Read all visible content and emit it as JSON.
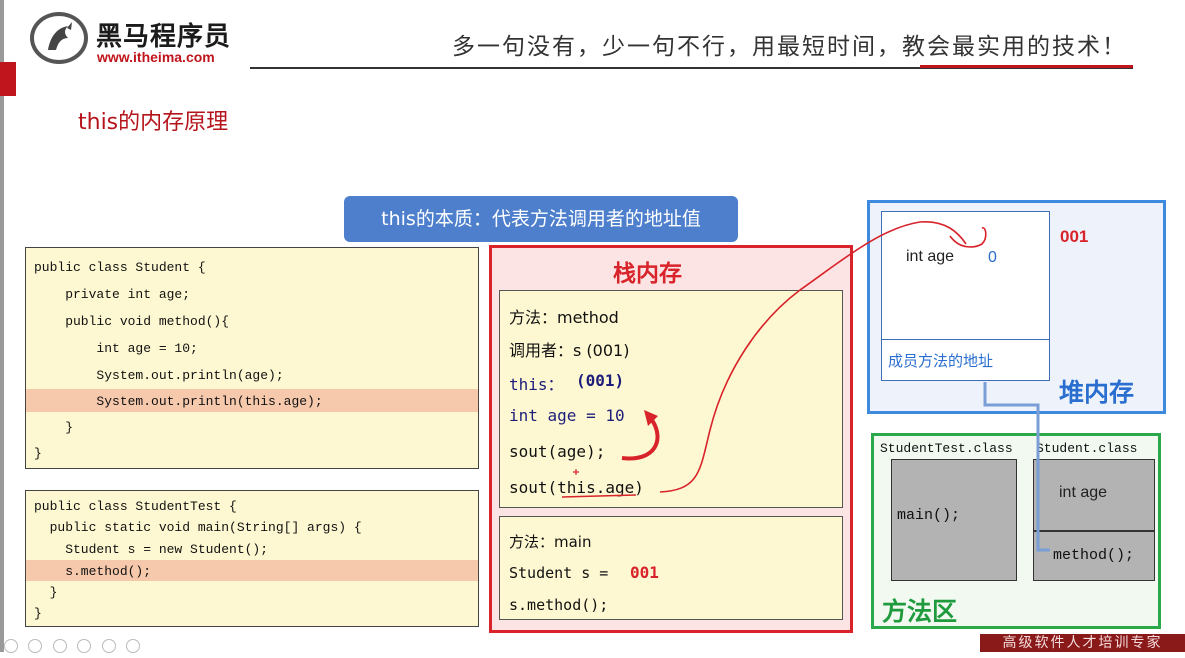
{
  "header": {
    "logo_text": "黑马程序员",
    "logo_url": "www.itheima.com",
    "slogan": "多一句没有，少一句不行，用最短时间，教会最实用的技术！"
  },
  "slide_title": "this的内存原理",
  "banner": "this的本质：代表方法调用者的地址值",
  "student_code": [
    "public class Student {",
    "    private int age;",
    "    public void method(){",
    "        int age = 10;",
    "        System.out.println(age);",
    "        System.out.println(this.age);",
    "    }",
    "}"
  ],
  "student_test_code": [
    "public class StudentTest {",
    "  public static void main(String[] args) {",
    "    Student s = new Student();",
    "    s.method();",
    "  }",
    "}"
  ],
  "stack": {
    "title": "栈内存",
    "method_frame": {
      "method_label": "方法：method",
      "caller_label": "调用者：s (001)",
      "this_label": "this：",
      "this_value": "(001)",
      "local_var": "int age = 10",
      "sout_age": "sout(age);",
      "sout_this_age": "sout(this.age)"
    },
    "main_frame": {
      "method_label": "方法：main",
      "student_decl": "Student s = ",
      "student_addr": "001",
      "call": "s.method();"
    }
  },
  "heap": {
    "title": "堆内存",
    "address": "001",
    "field_label": "int age",
    "field_value": "0",
    "method_ref": "成员方法的地址"
  },
  "method_area": {
    "title": "方法区",
    "student_test_class": "StudentTest.class",
    "student_class": "Student.class",
    "main_method": "main();",
    "field": "int age",
    "method": "method();"
  },
  "watermark": "高级软件人才培训专家",
  "colors": {
    "brand_red": "#c0151c",
    "stack_red": "#d8232a",
    "heap_blue": "#3d8ae0",
    "method_green": "#2aa84a",
    "banner_blue": "#4d7fcc",
    "code_bg": "#fdf8d2",
    "highlight": "#f6c9ad"
  }
}
